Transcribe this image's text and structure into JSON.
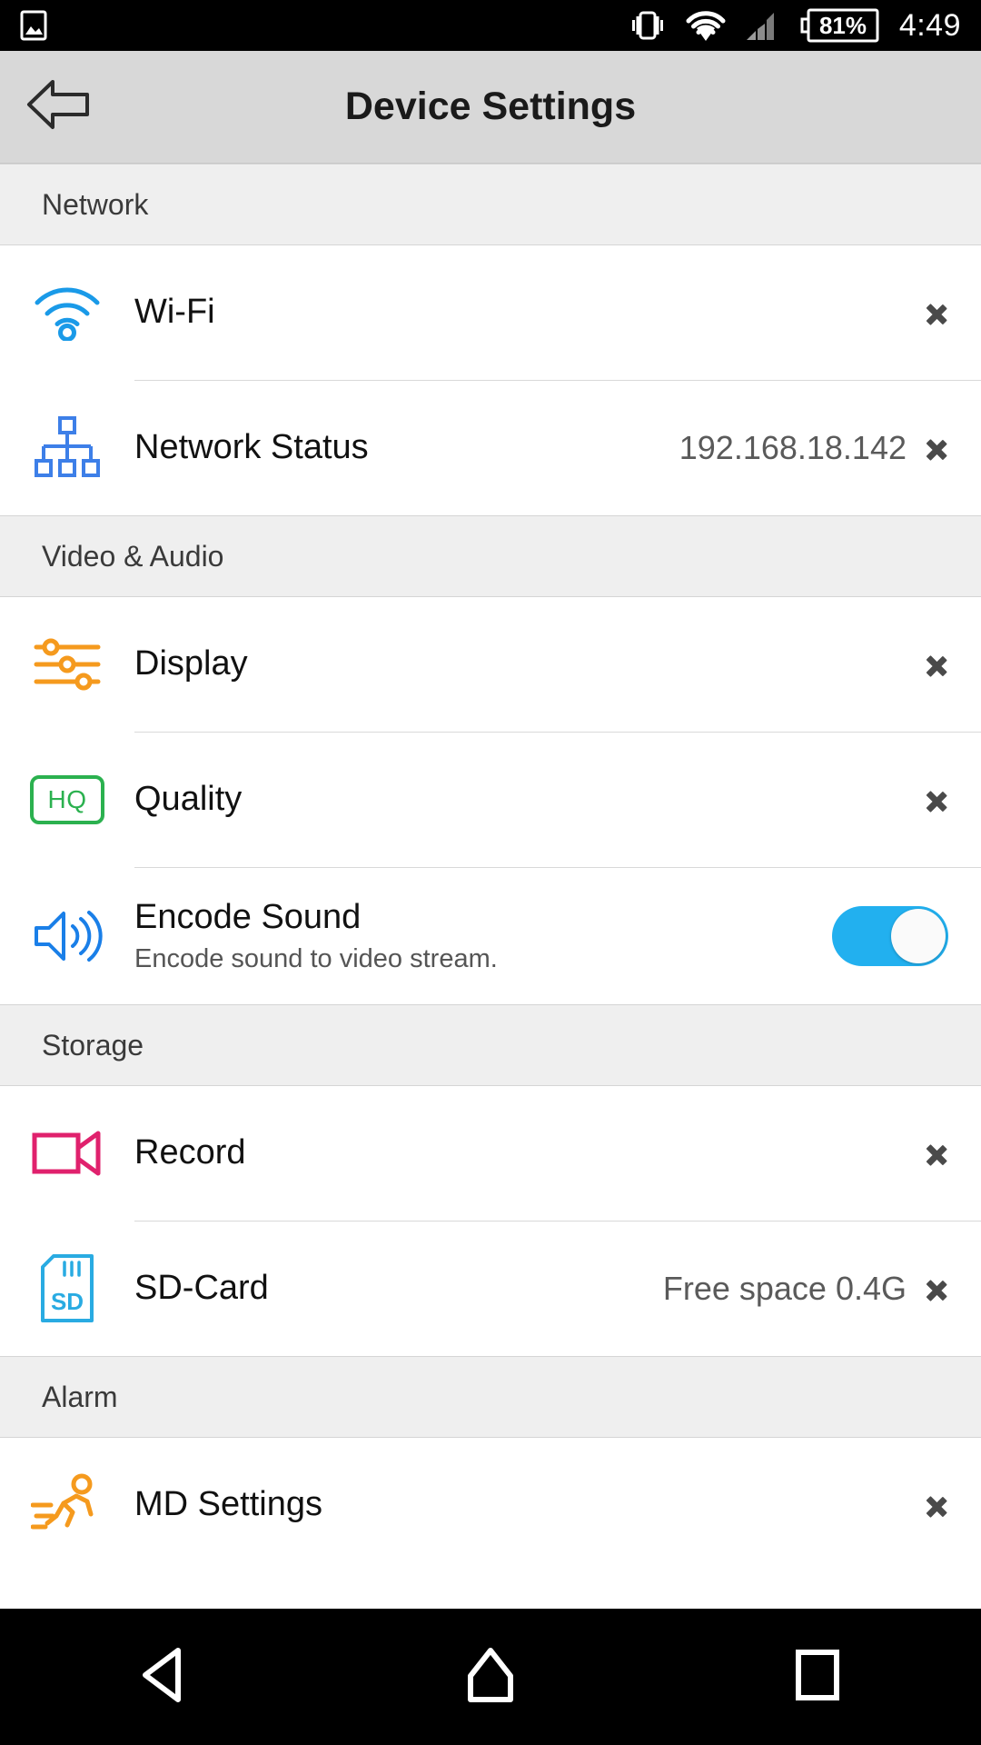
{
  "statusbar": {
    "clock": "4:49",
    "battery_percent": "81%",
    "icons": [
      "image-icon",
      "vibrate-icon",
      "wifi-icon",
      "cellular-signal-icon",
      "battery-icon"
    ]
  },
  "titlebar": {
    "title": "Device Settings",
    "back_label": "back-arrow-icon"
  },
  "colors": {
    "accent_blue": "#1a9ae8",
    "toggle_on": "#22b0ef",
    "orange": "#f59a1e",
    "green": "#2bb14f",
    "pink": "#e0216d",
    "sd_blue": "#29abe2",
    "section_bg": "#efefef",
    "titlebar_bg": "#d8d8d8"
  },
  "sections": [
    {
      "title": "Network",
      "rows": [
        {
          "label": "Wi-Fi",
          "value": "",
          "sub": "",
          "icon": "wifi-icon",
          "control": "chevron"
        },
        {
          "label": "Network Status",
          "value": "192.168.18.142",
          "sub": "",
          "icon": "network-tree-icon",
          "control": "chevron"
        }
      ]
    },
    {
      "title": "Video & Audio",
      "rows": [
        {
          "label": "Display",
          "value": "",
          "sub": "",
          "icon": "sliders-icon",
          "control": "chevron"
        },
        {
          "label": "Quality",
          "value": "",
          "sub": "",
          "icon": "hq-badge-icon",
          "control": "chevron"
        },
        {
          "label": "Encode Sound",
          "value": "",
          "sub": "Encode sound to video stream.",
          "icon": "speaker-icon",
          "control": "toggle",
          "toggle_on": true
        }
      ]
    },
    {
      "title": "Storage",
      "rows": [
        {
          "label": "Record",
          "value": "",
          "sub": "",
          "icon": "video-camera-icon",
          "control": "chevron"
        },
        {
          "label": "SD-Card",
          "value": "Free space 0.4G",
          "sub": "",
          "icon": "sd-card-icon",
          "control": "chevron"
        }
      ]
    },
    {
      "title": "Alarm",
      "rows": [
        {
          "label": "MD Settings",
          "value": "",
          "sub": "",
          "icon": "running-person-icon",
          "control": "chevron"
        }
      ]
    }
  ],
  "navbar": {
    "buttons": [
      {
        "name": "back",
        "icon": "nav-back-triangle-icon"
      },
      {
        "name": "home",
        "icon": "nav-home-icon"
      },
      {
        "name": "recents",
        "icon": "nav-recents-square-icon"
      }
    ]
  }
}
